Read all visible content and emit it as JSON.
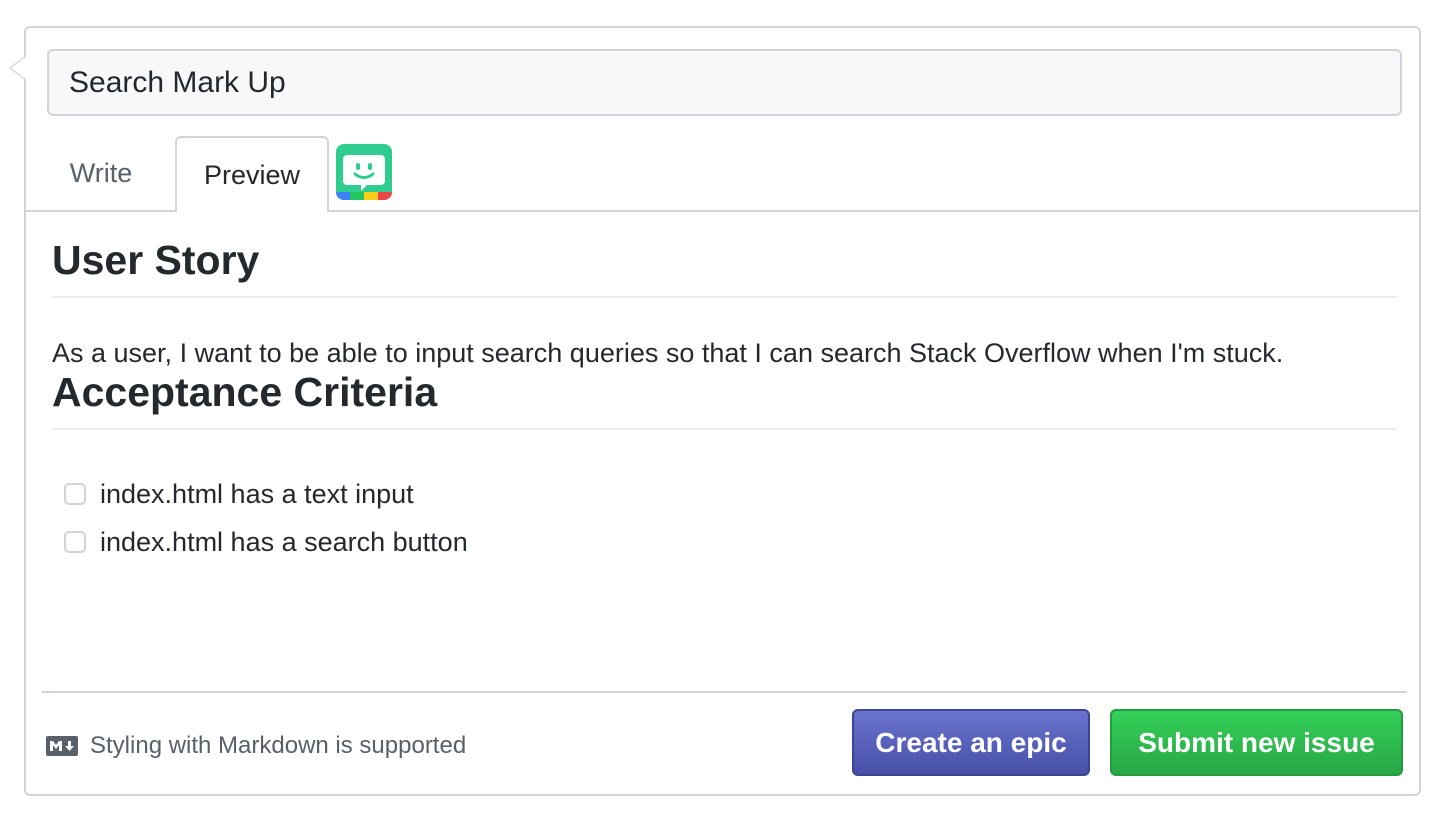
{
  "issue": {
    "title_value": "Search Mark Up"
  },
  "tabs": [
    {
      "label": "Write"
    },
    {
      "label": "Preview"
    }
  ],
  "preview": {
    "heading1": "User Story",
    "paragraph": "As a user, I want to be able to input search queries so that I can search Stack Overflow when I'm stuck.",
    "heading2": "Acceptance Criteria",
    "tasks": [
      {
        "label": "index.html has a text input",
        "checked": false
      },
      {
        "label": "index.html has a search button",
        "checked": false
      }
    ]
  },
  "footer": {
    "markdown_note": "Styling with Markdown is supported",
    "create_epic_label": "Create an epic",
    "submit_label": "Submit new issue"
  },
  "icons": {
    "extension": "zenhub-bot-icon",
    "markdown": "markdown-icon"
  },
  "colors": {
    "epic_button": "#4f58b3",
    "submit_button": "#2cbe4e",
    "border": "#d1d5da"
  }
}
